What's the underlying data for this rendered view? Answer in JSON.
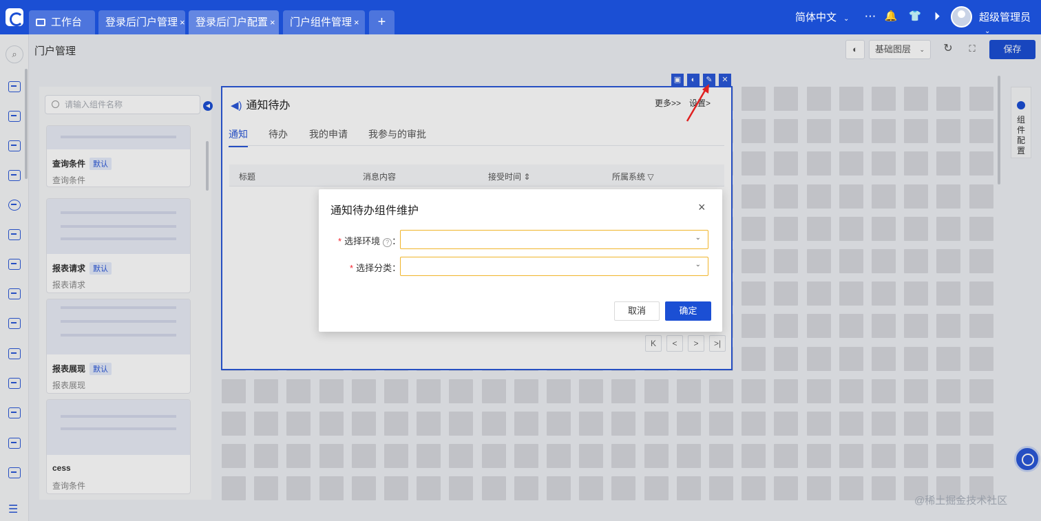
{
  "topbar": {
    "tabs": [
      {
        "label": "工作台",
        "closable": false
      },
      {
        "label": "登录后门户管理",
        "closable": true
      },
      {
        "label": "登录后门户配置",
        "closable": true,
        "active": true
      },
      {
        "label": "门户组件管理",
        "closable": true
      }
    ],
    "close_glyph": "×",
    "add_glyph": "+",
    "language": "简体中文",
    "language_chevron": "⌄",
    "icons": {
      "more": "⋯",
      "bell": "🔔",
      "shirt": "👕",
      "play": "⏵"
    },
    "username": "超级管理员",
    "user_chevron": "⌄"
  },
  "page": {
    "title": "门户管理",
    "layer_select": "基础图层",
    "layer_chevron": "⌄",
    "palette_icon": "◐",
    "refresh_icon": "↻",
    "fullscreen_icon": "⛶",
    "save_label": "保存"
  },
  "components": {
    "search_placeholder": "请输入组件名称",
    "default_tag": "默认",
    "items": [
      {
        "name": "查询条件",
        "desc": "查询条件",
        "is_default": true
      },
      {
        "name": "报表请求",
        "desc": "报表请求",
        "is_default": true
      },
      {
        "name": "报表展现",
        "desc": "报表展现",
        "is_default": true
      },
      {
        "name": "cess",
        "desc": "查询条件",
        "is_default": false
      }
    ]
  },
  "widget": {
    "title": "通知待办",
    "more_label": "更多>>",
    "settings_label": "设置>",
    "tabs": [
      "通知",
      "待办",
      "我的申请",
      "我参与的审批"
    ],
    "active_tab": 0,
    "columns": [
      "标题",
      "消息内容",
      "接受时间",
      "所属系统"
    ],
    "sort_icon": "⇕",
    "filter_icon": "▽",
    "pager": [
      "K",
      "<",
      ">",
      ">|"
    ]
  },
  "config_tab": {
    "label": "组件配置"
  },
  "modal": {
    "title": "通知待办组件维护",
    "fields": [
      {
        "label": "选择环境",
        "has_help": true,
        "value": ""
      },
      {
        "label": "选择分类",
        "has_help": false,
        "value": ""
      }
    ],
    "required_mark": "*",
    "help_glyph": "?",
    "colon": "：",
    "chevron": "⌄",
    "cancel_label": "取消",
    "ok_label": "确定",
    "close_glyph": "×"
  },
  "footer_watermark": "@稀土掘金技术社区",
  "colors": {
    "primary": "#1b4fd4",
    "warning_border": "#f0b429",
    "required": "#f5222d"
  }
}
